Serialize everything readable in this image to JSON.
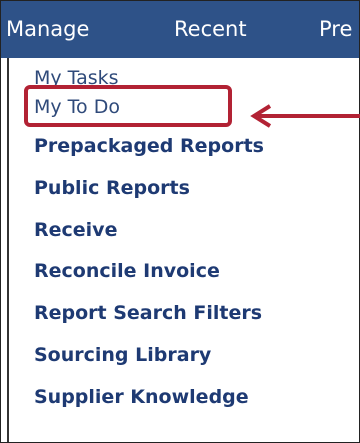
{
  "menubar": {
    "items": [
      {
        "label": "Manage"
      },
      {
        "label": "Recent"
      },
      {
        "label": "Pre"
      }
    ]
  },
  "dropdown": {
    "items": [
      {
        "label": "My Tasks"
      },
      {
        "label": "My To Do"
      },
      {
        "label": "Prepackaged Reports"
      },
      {
        "label": "Public Reports"
      },
      {
        "label": "Receive"
      },
      {
        "label": "Reconcile Invoice"
      },
      {
        "label": "Report Search Filters"
      },
      {
        "label": "Sourcing Library"
      },
      {
        "label": "Supplier Knowledge"
      }
    ]
  },
  "annotation": {
    "color": "#b22234",
    "highlighted_item": "My To Do"
  },
  "colors": {
    "menubar_bg": "#2e5288",
    "link": "#1e3a73"
  }
}
